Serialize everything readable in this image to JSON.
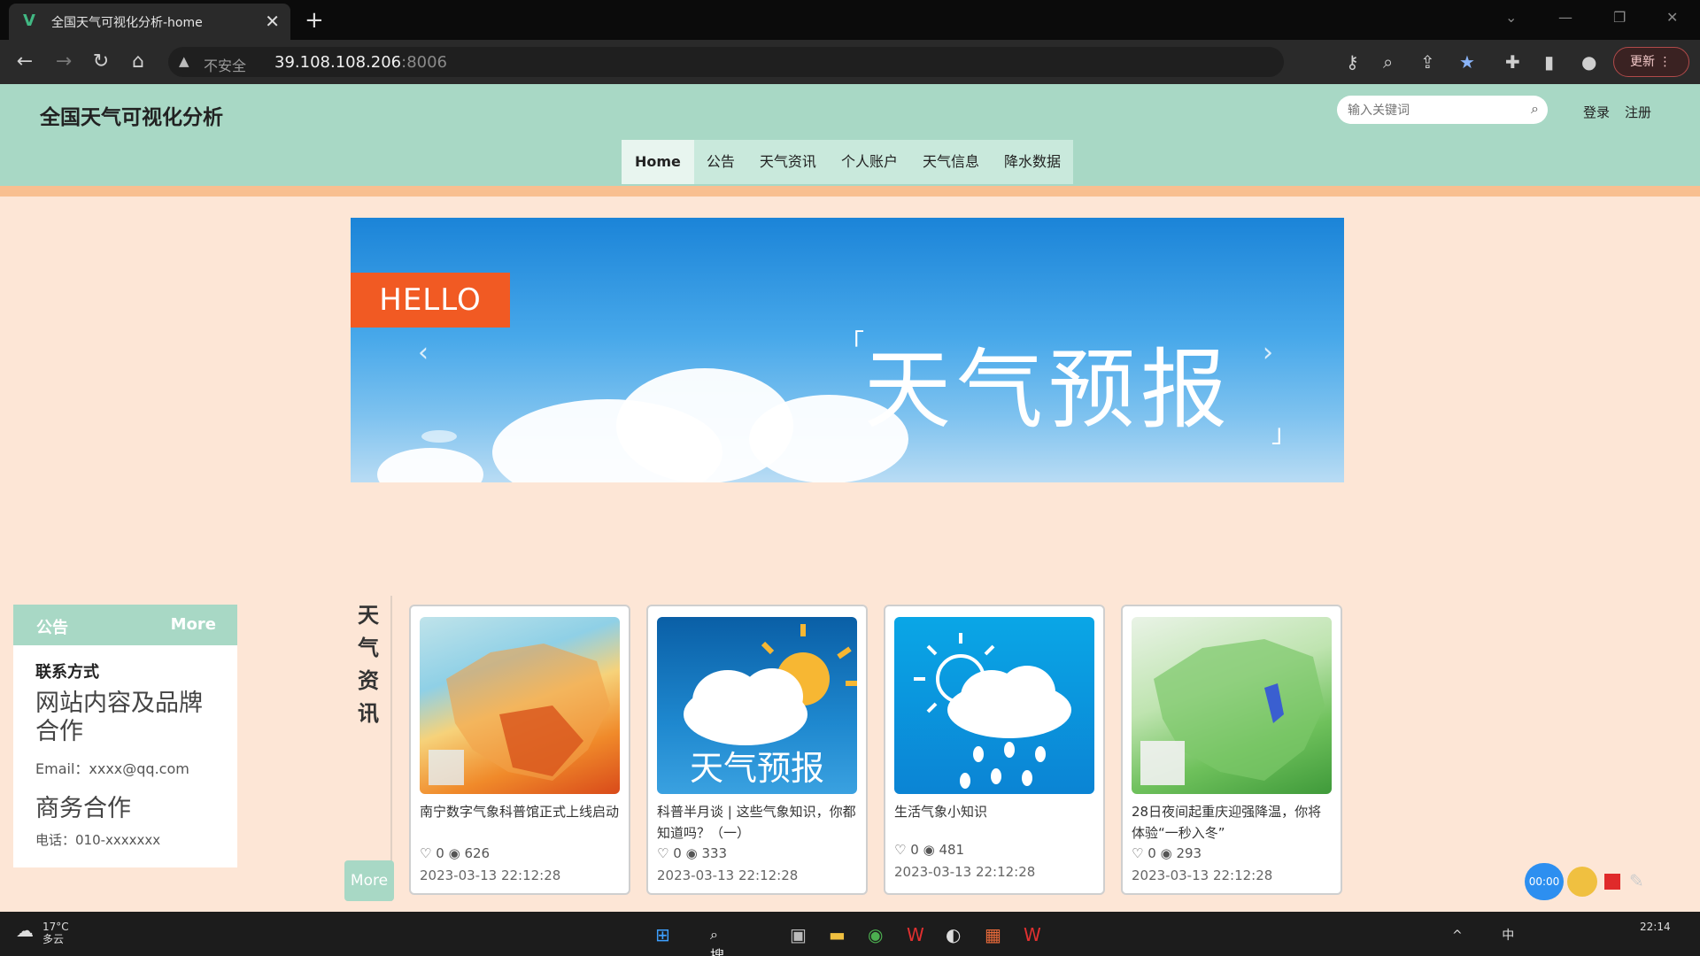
{
  "browser": {
    "tab_title": "全国天气可视化分析-home",
    "tab_favicon": "V",
    "close_glyph": "✕",
    "new_tab_glyph": "+",
    "insecure_label": "不安全",
    "url_host": "39.108.108.206",
    "url_port": ":8006",
    "update_label": "更新"
  },
  "site": {
    "title": "全国天气可视化分析",
    "search_placeholder": "输入关键词",
    "login": "登录",
    "register": "注册",
    "nav": [
      {
        "label": "Home"
      },
      {
        "label": "公告"
      },
      {
        "label": "天气资讯"
      },
      {
        "label": "个人账户"
      },
      {
        "label": "天气信息"
      },
      {
        "label": "降水数据"
      }
    ]
  },
  "banner": {
    "hello": "HELLO",
    "text": "天气预报",
    "bracket_open": "「",
    "bracket_close": "」"
  },
  "notice": {
    "title": "公告",
    "more": "More",
    "contact_label": "联系方式",
    "brand_coop": "网站内容及品牌合作",
    "email": "Email：xxxx@qq.com",
    "business": "商务合作",
    "phone": "电话：010-xxxxxxx"
  },
  "news": {
    "section_label": [
      "天",
      "气",
      "资",
      "讯"
    ],
    "more": "More",
    "cards": [
      {
        "title": "南宁数字气象科普馆正式上线启动",
        "likes": "0",
        "views": "626",
        "date": "2023-03-13 22:12:28"
      },
      {
        "title": "科普半月谈 | 这些气象知识，你都知道吗？（一）",
        "likes": "0",
        "views": "333",
        "date": "2023-03-13 22:12:28",
        "image_text": "天气预报"
      },
      {
        "title": "生活气象小知识",
        "likes": "0",
        "views": "481",
        "date": "2023-03-13 22:12:28"
      },
      {
        "title": "28日夜间起重庆迎强降温，你将体验“一秒入冬”",
        "likes": "0",
        "views": "293",
        "date": "2023-03-13 22:12:28"
      }
    ]
  },
  "recorder": {
    "time": "00:00"
  },
  "taskbar": {
    "temp": "17°C",
    "weather": "多云",
    "search": "搜索",
    "ime": "中",
    "time": "22:14"
  }
}
